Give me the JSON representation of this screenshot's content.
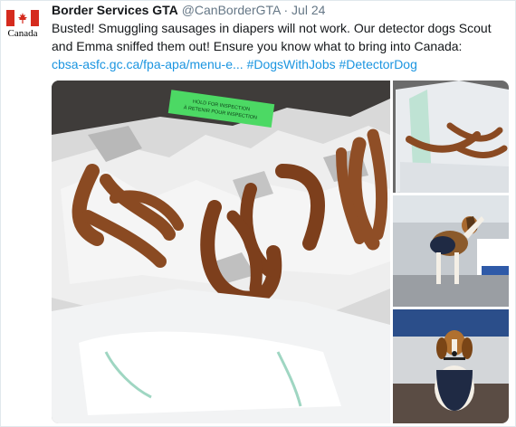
{
  "account": {
    "avatar_label": "Canada",
    "avatar_icon": "canada-flag-icon",
    "name": "Border Services GTA",
    "handle": "@CanBorderGTA",
    "separator": "·",
    "date": "Jul 24"
  },
  "tweet": {
    "line1": "Busted! Smuggling sausages in diapers will not work. Our detector dogs Scout",
    "line2": "and Emma sniffed them out! Ensure you know what to bring into Canada:",
    "link": "cbsa-asfc.gc.ca/fpa-apa/menu-e...",
    "hashtag1": "#DogsWithJobs",
    "hashtag2": "#DetectorDog"
  },
  "media": {
    "label_line1": "HOLD FOR INSPECTION",
    "label_line2": "À RETENIR POUR INSPECTION",
    "colors": {
      "label_green": "#4cd964",
      "sausage": "#8a4a22",
      "diaper": "#eef0f2",
      "vest": "#1f2a44",
      "floor": "#9a9ea3"
    }
  },
  "colors": {
    "link": "#1b95e0",
    "text": "#14171a",
    "muted": "#657786",
    "canada_red": "#d52b1e"
  }
}
